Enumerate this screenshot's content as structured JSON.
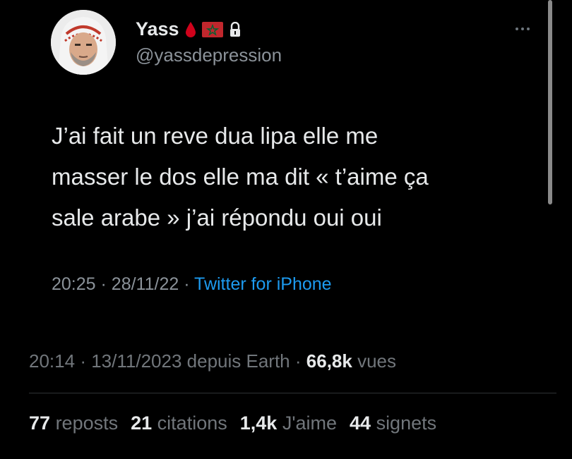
{
  "embedded_tweet": {
    "display_name": "Yass",
    "handle": "@yassdepression",
    "body_lines": [
      "J’ai fait un reve dua lipa elle me",
      "masser le dos elle ma dit  « t’aime ça",
      "sale arabe » j’ai répondu oui oui"
    ],
    "time": "20:25",
    "date": "28/11/22",
    "separator": "·",
    "source": "Twitter for iPhone",
    "badges": [
      "drop-icon",
      "morocco-flag-icon",
      "lock-icon"
    ],
    "colors": {
      "drop": "#d0021b",
      "flag": "#c1272d",
      "source_link": "#1d9bf0"
    }
  },
  "post": {
    "time": "20:14",
    "date": "13/11/2023",
    "location": "depuis Earth",
    "separator": "·",
    "views_count": "66,8k",
    "views_label": "vues"
  },
  "stats": [
    {
      "count": "77",
      "label": "reposts"
    },
    {
      "count": "21",
      "label": "citations"
    },
    {
      "count": "1,4k",
      "label": "J'aime"
    },
    {
      "count": "44",
      "label": "signets"
    }
  ]
}
